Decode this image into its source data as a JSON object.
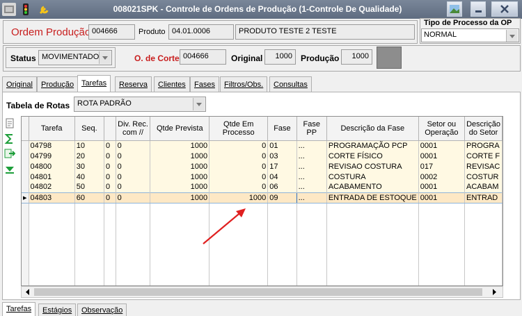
{
  "window": {
    "title": "008021SPK - Controle de Ordens de Produção (1-Controle De Qualidade)"
  },
  "header": {
    "ordem_label": "Ordem Produção",
    "ordem_value": "004666",
    "produto_label": "Produto",
    "produto_code": "04.01.0006",
    "produto_desc": "PRODUTO TESTE 2 TESTE",
    "tipo_label": "Tipo de Processo da OP",
    "tipo_value": "NORMAL",
    "status_label": "Status",
    "status_value": "MOVIMENTADO",
    "corte_label": "O. de Corte",
    "corte_value": "004666",
    "original_label": "Original",
    "original_value": "1000",
    "producao_label": "Produção",
    "producao_value": "1000"
  },
  "tabs": [
    "Original",
    "Produção",
    "Tarefas",
    "Reserva",
    "Clientes",
    "Fases",
    "Filtros/Obs.",
    "Consultas"
  ],
  "active_tab": "Tarefas",
  "rotas": {
    "label": "Tabela de Rotas",
    "value": "ROTA PADRÃO"
  },
  "grid": {
    "columns": [
      "Tarefa",
      "Seq.",
      "",
      "Div. Rec. com //",
      "Qtde Prevista",
      "Qtde Em Processo",
      "Fase",
      "Fase PP",
      "Descrição da Fase",
      "Setor ou Operação",
      "Descrição do Setor"
    ],
    "rows": [
      [
        "04798",
        "10",
        "0",
        "0",
        "1000",
        "0",
        "01",
        "...",
        "PROGRAMAÇÃO PCP",
        "0001",
        "PROGRA"
      ],
      [
        "04799",
        "20",
        "0",
        "0",
        "1000",
        "0",
        "03",
        "...",
        "CORTE FÍSICO",
        "0001",
        "CORTE F"
      ],
      [
        "04800",
        "30",
        "0",
        "0",
        "1000",
        "0",
        "17",
        "...",
        "REVISAO COSTURA",
        "017",
        "REVISAC"
      ],
      [
        "04801",
        "40",
        "0",
        "0",
        "1000",
        "0",
        "04",
        "...",
        "COSTURA",
        "0002",
        "COSTUR"
      ],
      [
        "04802",
        "50",
        "0",
        "0",
        "1000",
        "0",
        "06",
        "...",
        "ACABAMENTO",
        "0001",
        "ACABAM"
      ],
      [
        "04803",
        "60",
        "0",
        "0",
        "1000",
        "1000",
        "09",
        "...",
        "ENTRADA DE ESTOQUE",
        "0001",
        "ENTRAD"
      ]
    ],
    "selected_row": 5
  },
  "bottom_tabs": [
    "Tarefas",
    "Estágios",
    "Observação"
  ],
  "colors": {
    "title_bar": "#6b788c",
    "red_label": "#c81e1e",
    "row_bg": "#fff9e3",
    "arrow": "#e02020"
  }
}
